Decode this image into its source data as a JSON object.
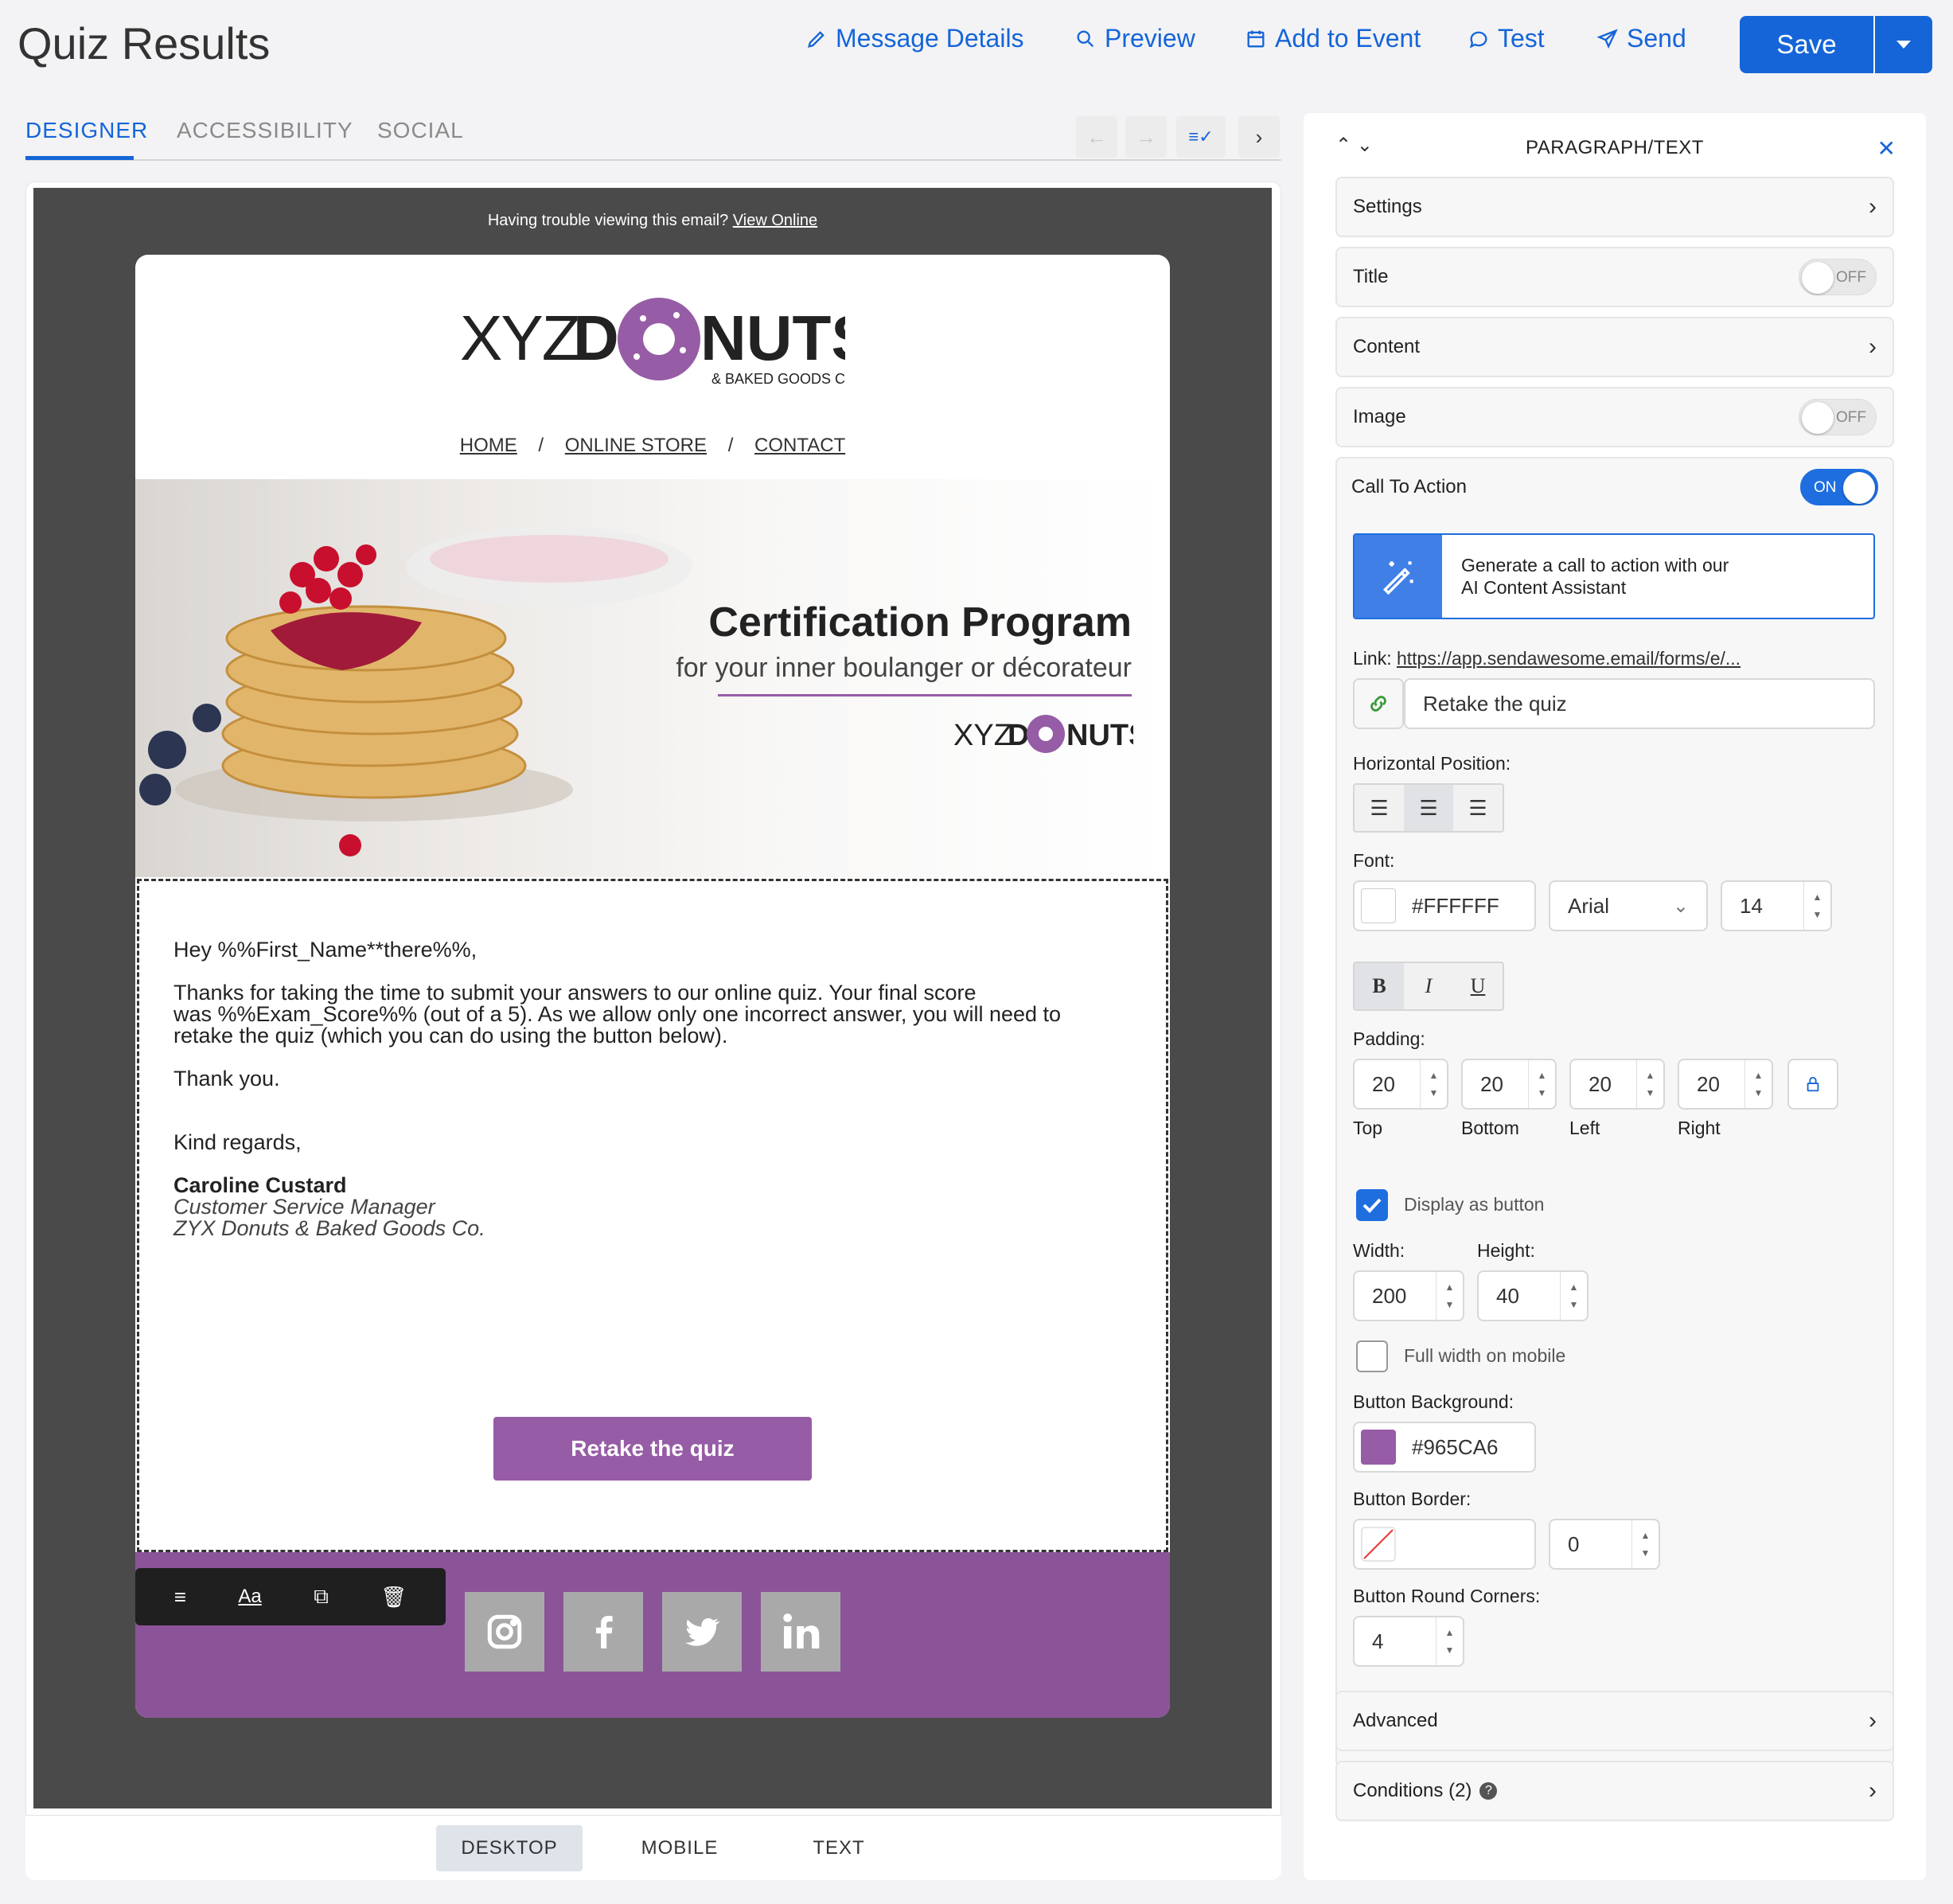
{
  "header": {
    "title": "Quiz Results",
    "nav": [
      {
        "label": "Message Details",
        "icon": "pencil-icon"
      },
      {
        "label": "Preview",
        "icon": "search-icon"
      },
      {
        "label": "Add to Event",
        "icon": "calendar-icon"
      },
      {
        "label": "Test",
        "icon": "chat-icon"
      },
      {
        "label": "Send",
        "icon": "send-icon"
      }
    ],
    "save_label": "Save",
    "accent_color": "#1565D8"
  },
  "tabs": [
    "DESIGNER",
    "ACCESSIBILITY",
    "SOCIAL"
  ],
  "email": {
    "trouble_text": "Having trouble viewing this email?",
    "view_online": "View Online",
    "logo_text": "XYZ DONUTS",
    "logo_tagline": "& BAKED GOODS CO.",
    "nav": [
      "HOME",
      "ONLINE STORE",
      "CONTACT"
    ],
    "nav_sep": "/",
    "hero_title": "Certification Program",
    "hero_subtitle": "for your inner boulanger or décorateur",
    "greeting": "Hey %%First_Name**there%%,",
    "para1": "Thanks for taking the time to submit your answers to our online quiz. Your final score",
    "para2": "was %%Exam_Score%% (out of a 5). As we allow only one incorrect answer, you will need to",
    "para3": "retake the quiz (which you can do using the button below).",
    "thanks": "Thank you.",
    "regards": "Kind regards,",
    "sig_name": "Caroline Custard",
    "sig_title": "Customer Service Manager",
    "sig_company": "ZYX Donuts & Baked Goods Co.",
    "cta": "Retake the quiz",
    "brand_color": "#965CA6",
    "footer_color": "#8B5498",
    "social": [
      "instagram-icon",
      "facebook-icon",
      "twitter-icon",
      "linkedin-icon"
    ]
  },
  "view_modes": [
    "DESKTOP",
    "MOBILE",
    "TEXT"
  ],
  "panel": {
    "title": "PARAGRAPH/TEXT",
    "sections": {
      "settings": "Settings",
      "title": "Title",
      "content": "Content",
      "image": "Image",
      "cta": "Call To Action",
      "advanced": "Advanced",
      "conditions": "Conditions (2)"
    },
    "toggle_off": "OFF",
    "toggle_on": "ON",
    "ai_line1": "Generate a call to action with our",
    "ai_line2": "AI Content Assistant",
    "link_label": "Link:",
    "link_url": "https://app.sendawesome.email/forms/e/...",
    "link_text": "Retake the quiz",
    "hpos_label": "Horizontal Position:",
    "font_label": "Font:",
    "font_color": "#FFFFFF",
    "font_family": "Arial",
    "font_size": "14",
    "format": [
      "B",
      "I",
      "U"
    ],
    "padding_label": "Padding:",
    "padding": [
      {
        "value": "20",
        "label": "Top"
      },
      {
        "value": "20",
        "label": "Bottom"
      },
      {
        "value": "20",
        "label": "Left"
      },
      {
        "value": "20",
        "label": "Right"
      }
    ],
    "display_button": "Display as button",
    "width_label": "Width:",
    "height_label": "Height:",
    "width": "200",
    "height": "40",
    "full_width_mobile": "Full width on mobile",
    "bg_label": "Button Background:",
    "bg_color": "#965CA6",
    "border_label": "Button Border:",
    "border_width": "0",
    "corners_label": "Button Round Corners:",
    "corners": "4"
  }
}
